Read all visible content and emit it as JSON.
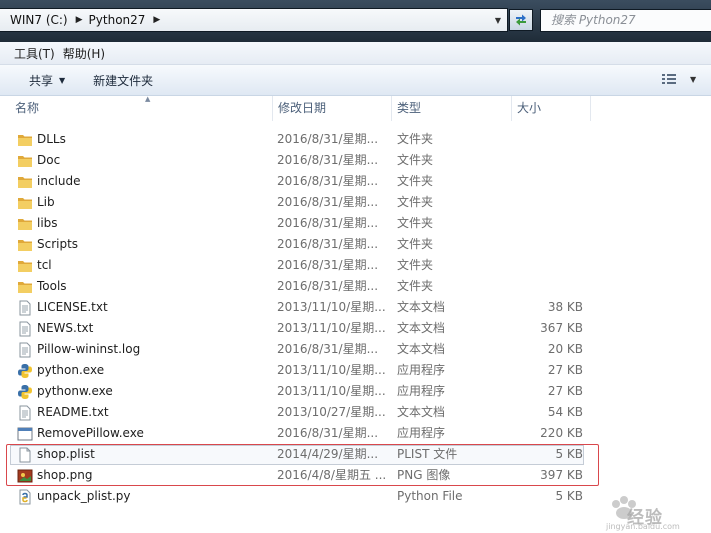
{
  "address": {
    "crumbs": [
      "WIN7 (C:)",
      "Python27"
    ],
    "search_placeholder": "搜索 Python27"
  },
  "menu": {
    "tools": "工具(T)",
    "help": "帮助(H)"
  },
  "toolbar": {
    "share": "共享",
    "new_folder": "新建文件夹"
  },
  "columns": {
    "name": "名称",
    "date": "修改日期",
    "type": "类型",
    "size": "大小"
  },
  "files": [
    {
      "name": "DLLs",
      "date": "2016/8/31/星期...",
      "type": "文件夹",
      "size": "",
      "icon": "folder"
    },
    {
      "name": "Doc",
      "date": "2016/8/31/星期...",
      "type": "文件夹",
      "size": "",
      "icon": "folder"
    },
    {
      "name": "include",
      "date": "2016/8/31/星期...",
      "type": "文件夹",
      "size": "",
      "icon": "folder"
    },
    {
      "name": "Lib",
      "date": "2016/8/31/星期...",
      "type": "文件夹",
      "size": "",
      "icon": "folder"
    },
    {
      "name": "libs",
      "date": "2016/8/31/星期...",
      "type": "文件夹",
      "size": "",
      "icon": "folder"
    },
    {
      "name": "Scripts",
      "date": "2016/8/31/星期...",
      "type": "文件夹",
      "size": "",
      "icon": "folder"
    },
    {
      "name": "tcl",
      "date": "2016/8/31/星期...",
      "type": "文件夹",
      "size": "",
      "icon": "folder"
    },
    {
      "name": "Tools",
      "date": "2016/8/31/星期...",
      "type": "文件夹",
      "size": "",
      "icon": "folder"
    },
    {
      "name": "LICENSE.txt",
      "date": "2013/11/10/星期...",
      "type": "文本文档",
      "size": "38 KB",
      "icon": "text"
    },
    {
      "name": "NEWS.txt",
      "date": "2013/11/10/星期...",
      "type": "文本文档",
      "size": "367 KB",
      "icon": "text"
    },
    {
      "name": "Pillow-wininst.log",
      "date": "2016/8/31/星期...",
      "type": "文本文档",
      "size": "20 KB",
      "icon": "text"
    },
    {
      "name": "python.exe",
      "date": "2013/11/10/星期...",
      "type": "应用程序",
      "size": "27 KB",
      "icon": "python"
    },
    {
      "name": "pythonw.exe",
      "date": "2013/11/10/星期...",
      "type": "应用程序",
      "size": "27 KB",
      "icon": "python"
    },
    {
      "name": "README.txt",
      "date": "2013/10/27/星期...",
      "type": "文本文档",
      "size": "54 KB",
      "icon": "text"
    },
    {
      "name": "RemovePillow.exe",
      "date": "2016/8/31/星期...",
      "type": "应用程序",
      "size": "220 KB",
      "icon": "app"
    },
    {
      "name": "shop.plist",
      "date": "2014/4/29/星期...",
      "type": "PLIST 文件",
      "size": "5 KB",
      "icon": "blank"
    },
    {
      "name": "shop.png",
      "date": "2016/4/8/星期五 ...",
      "type": "PNG 图像",
      "size": "397 KB",
      "icon": "image"
    },
    {
      "name": "unpack_plist.py",
      "date": "",
      "type": "Python File",
      "size": "5 KB",
      "icon": "pyfile"
    }
  ],
  "watermark": {
    "text": "经验",
    "sub": "jingyan.baidu.com"
  },
  "colors": {
    "address_bg": "#2a3a4a",
    "highlight": "#d9474c",
    "folder": "#e9b949"
  }
}
